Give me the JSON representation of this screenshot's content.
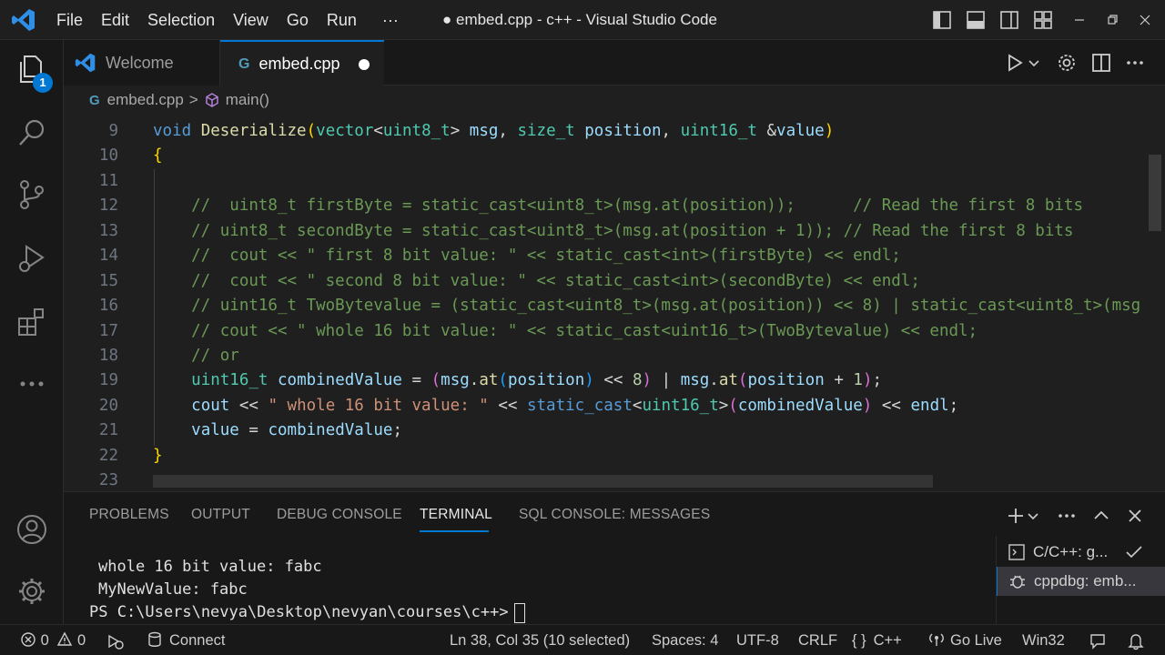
{
  "colors": {
    "accent": "#0078d4",
    "background": "#1f1f1f",
    "sidebar": "#181818"
  },
  "menu": [
    "File",
    "Edit",
    "Selection",
    "View",
    "Go",
    "Run",
    "···"
  ],
  "window_title": "● embed.cpp - c++ - Visual Studio Code",
  "activity": {
    "explorer_badge": "1"
  },
  "tabs": [
    {
      "label": "Welcome",
      "icon": "vscode-logo-icon"
    },
    {
      "label": "embed.cpp",
      "icon": "cpp-file-icon",
      "dirty": true
    }
  ],
  "tab_glyph": "G",
  "breadcrumb": {
    "file": "embed.cpp",
    "separator": ">",
    "symbol": "main()"
  },
  "editor": {
    "line_numbers": [
      "9",
      "10",
      "11",
      "12",
      "13",
      "14",
      "15",
      "16",
      "17",
      "18",
      "19",
      "20",
      "21",
      "22",
      "23"
    ]
  },
  "panel": {
    "tabs": [
      "PROBLEMS",
      "OUTPUT",
      "DEBUG CONSOLE",
      "TERMINAL",
      "SQL CONSOLE: MESSAGES"
    ],
    "active_tab": "TERMINAL",
    "terminal_lines": [
      "whole 16 bit value: fabc",
      "MyNewValue: fabc",
      "PS C:\\Users\\nevya\\Desktop\\nevyan\\courses\\c++>"
    ],
    "terminals": [
      "C/C++: g...",
      "cppdbg: emb..."
    ]
  },
  "status": {
    "errors": "0",
    "warnings": "0",
    "connect": "Connect",
    "cursor": "Ln 38, Col 35 (10 selected)",
    "spaces": "Spaces: 4",
    "encoding": "UTF-8",
    "eol": "CRLF",
    "language_icon": "{ }",
    "language": "C++",
    "go_live": "Go Live",
    "platform": "Win32"
  }
}
